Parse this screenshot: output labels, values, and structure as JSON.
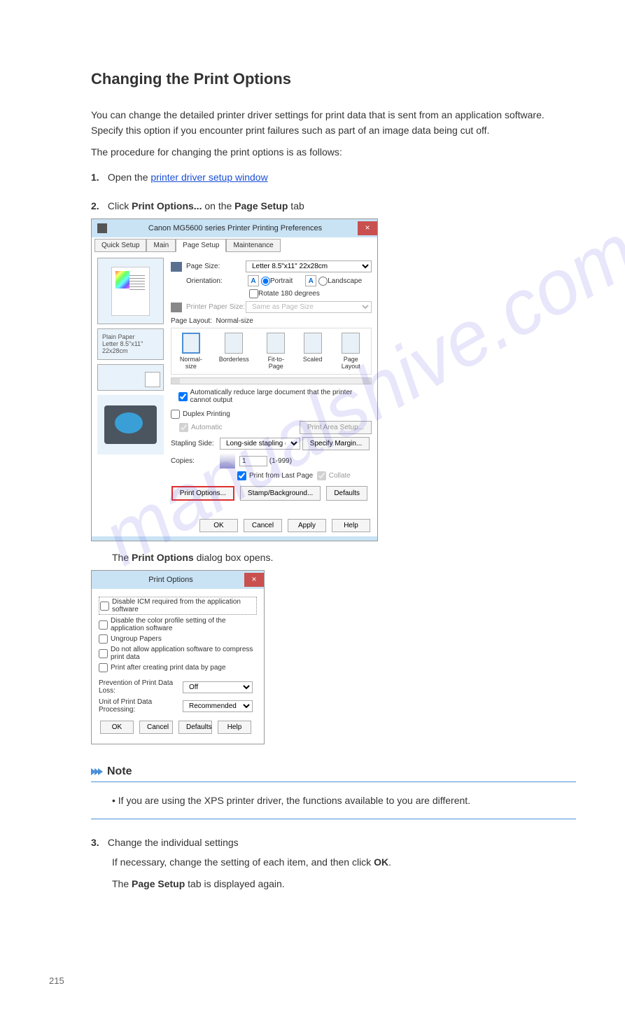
{
  "title": "Changing the Print Options",
  "intro": {
    "p1": "You can change the detailed printer driver settings for print data that is sent from an application software.",
    "p2": "Specify this option if you encounter print failures such as part of an image data being cut off.",
    "p3": "The procedure for changing the print options is as follows:"
  },
  "step1": {
    "num": "1.",
    "text_pre": "Open the ",
    "link": "printer driver setup window"
  },
  "step2": {
    "num": "2.",
    "label_click": "Click ",
    "label_po": "Print Options...",
    "label_on": " on the ",
    "label_ps": "Page Setup",
    "label_tab": " tab",
    "result_pre": "The ",
    "result_po": "Print Options",
    "result_post": " dialog box opens."
  },
  "dlg1": {
    "title": "Canon MG5600 series Printer Printing Preferences",
    "tabs": {
      "t1": "Quick Setup",
      "t2": "Main",
      "t3": "Page Setup",
      "t4": "Maintenance"
    },
    "page_size_label": "Page Size:",
    "page_size_val": "Letter 8.5\"x11\" 22x28cm",
    "orientation_label": "Orientation:",
    "portrait": "Portrait",
    "landscape": "Landscape",
    "rotate": "Rotate 180 degrees",
    "printer_paper_label": "Printer Paper Size:",
    "printer_paper_val": "Same as Page Size",
    "page_layout_label": "Page Layout:",
    "page_layout_val": "Normal-size",
    "layouts": {
      "l1": "Normal-size",
      "l2": "Borderless",
      "l3": "Fit-to-Page",
      "l4": "Scaled",
      "l5": "Page Layout"
    },
    "auto_reduce": "Automatically reduce large document that the printer cannot output",
    "duplex": "Duplex Printing",
    "automatic": "Automatic",
    "print_area": "Print Area Setup...",
    "stapling_label": "Stapling Side:",
    "stapling_val": "Long-side stapling (Left)",
    "specify_margin": "Specify Margin...",
    "copies_label": "Copies:",
    "copies_val": "1",
    "copies_range": "(1-999)",
    "from_last": "Print from Last Page",
    "collate": "Collate",
    "btns": {
      "po": "Print Options...",
      "sb": "Stamp/Background...",
      "def": "Defaults",
      "ok": "OK",
      "cancel": "Cancel",
      "apply": "Apply",
      "help": "Help"
    },
    "info": {
      "line1": "Plain Paper",
      "line2": "Letter 8.5\"x11\" 22x28cm"
    }
  },
  "dlg2": {
    "title": "Print Options",
    "c1": "Disable ICM required from the application software",
    "c1_hl": "Disable ICM required from the application software",
    "c2": "Disable the color profile setting of the application software",
    "c3": "Ungroup Papers",
    "c4": "Do not allow application software to compress print data",
    "c5": "Print after creating print data by page",
    "pdl_label": "Prevention of Print Data Loss:",
    "pdl_val": "Off",
    "upd_label": "Unit of Print Data Processing:",
    "upd_val": "Recommended",
    "ok": "OK",
    "cancel": "Cancel",
    "def": "Defaults",
    "help": "Help"
  },
  "note": {
    "title": "Note",
    "text": "If you are using the XPS printer driver, the functions available to you are different."
  },
  "step3": {
    "num": "3.",
    "text": "Change the individual settings",
    "line1": "If necessary, change the setting of each item, and then click ",
    "ok": "OK",
    "period": ".",
    "line2_pre": "The ",
    "line2_ps": "Page Setup",
    "line2_post": " tab is displayed again."
  },
  "page_num": "215"
}
